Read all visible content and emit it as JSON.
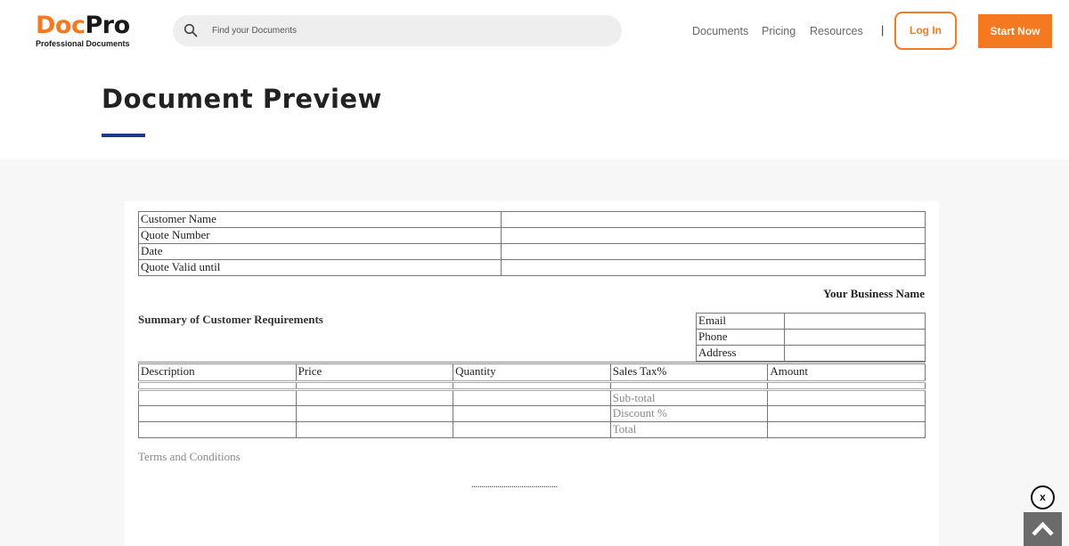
{
  "brand": {
    "logo_left": "Doc",
    "logo_right": "Pro",
    "tagline": "Professional Documents",
    "accent_color": "#f47920",
    "underline_color": "#1a3a8a"
  },
  "search": {
    "placeholder": "Find your Documents",
    "icon": "search-icon"
  },
  "nav": {
    "items": [
      "Documents",
      "Pricing",
      "Resources"
    ],
    "separator": "|",
    "login_label": "Log In",
    "start_label": "Start Now"
  },
  "page": {
    "title": "Document Preview"
  },
  "document": {
    "info_rows": [
      "Customer Name",
      "Quote Number",
      "Date",
      "Quote Valid until"
    ],
    "business_name": "Your Business Name",
    "summary_heading": "Summary of Customer Requirements",
    "contact_rows": [
      "Email",
      "Phone",
      "Address"
    ],
    "item_columns": [
      "Description",
      "Price",
      "Quantity",
      "Sales Tax%",
      "Amount"
    ],
    "totals": [
      "Sub-total",
      "Discount %",
      "Total"
    ],
    "terms": "Terms and Conditions",
    "signature_line": "..........................................."
  },
  "controls": {
    "close_label": "x",
    "close_icon": "close-icon",
    "top_icon": "chevron-up-icon"
  }
}
